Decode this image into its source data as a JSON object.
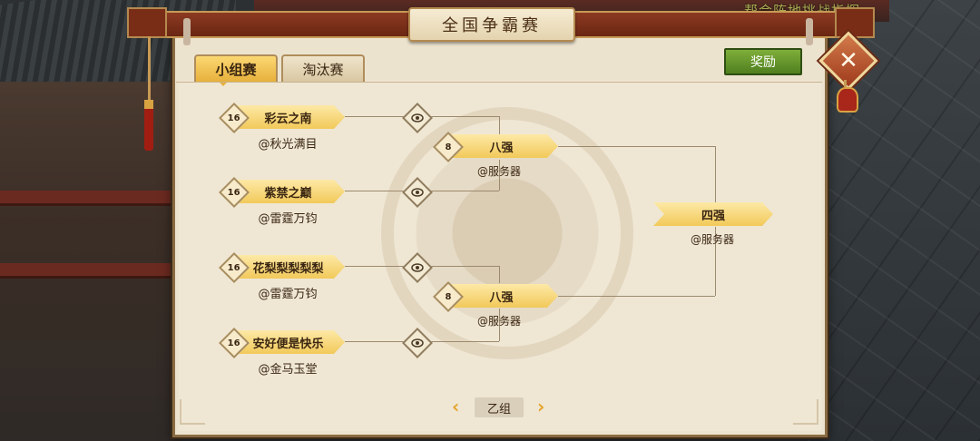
{
  "background_text": "帮会阵地挑战指挥",
  "title": "全国争霸赛",
  "tabs": [
    {
      "label": "小组赛",
      "active": true
    },
    {
      "label": "淘汰赛",
      "active": false
    }
  ],
  "reward_button": "奖励",
  "close_icon": "✕",
  "round16": [
    {
      "seed": "16",
      "name": "彩云之南",
      "server": "@秋光满目"
    },
    {
      "seed": "16",
      "name": "紫禁之巅",
      "server": "@雷霆万钧"
    },
    {
      "seed": "16",
      "name": "花梨梨梨梨梨",
      "server": "@雷霆万钧"
    },
    {
      "seed": "16",
      "name": "安好便是快乐",
      "server": "@金马玉堂"
    }
  ],
  "round8": [
    {
      "seed": "8",
      "name": "八强",
      "server": "@服务器"
    },
    {
      "seed": "8",
      "name": "八强",
      "server": "@服务器"
    }
  ],
  "round4": {
    "name": "四强",
    "server": "@服务器"
  },
  "group_nav": {
    "prev": "‹",
    "label": "乙组",
    "next": "›"
  },
  "colors": {
    "pill": "#f2c95a",
    "panel": "#ece3cf",
    "reward": "#5f8f28",
    "accent": "#e3a42a"
  }
}
